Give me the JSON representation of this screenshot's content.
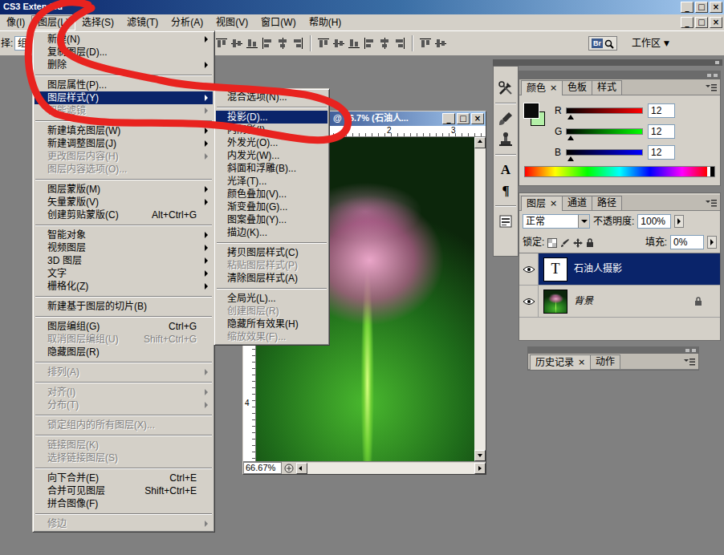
{
  "window": {
    "title": "CS3 Extended",
    "controls": [
      "_",
      "□",
      "×"
    ]
  },
  "menubar": {
    "items": [
      {
        "label": "像(I)",
        "selected": false
      },
      {
        "label": "图层(L)",
        "selected": true
      },
      {
        "label": "选择(S)",
        "selected": false
      },
      {
        "label": "滤镜(T)",
        "selected": false
      },
      {
        "label": "分析(A)",
        "selected": false
      },
      {
        "label": "视图(V)",
        "selected": false
      },
      {
        "label": "窗口(W)",
        "selected": false
      },
      {
        "label": "帮助(H)",
        "selected": false
      }
    ],
    "controls": [
      "_",
      "□",
      "×"
    ]
  },
  "options_bar": {
    "label": "择:",
    "dropdown": "组",
    "bridge": "Br",
    "workspace": "工作区",
    "workspace_arrow": "▼"
  },
  "layer_menu": {
    "groups": [
      [
        {
          "label": "新建(N)",
          "submenu": true,
          "disabled": false,
          "selected": false
        },
        {
          "label": "复制图层(D)...",
          "submenu": false,
          "disabled": false,
          "selected": false
        },
        {
          "label": "删除",
          "submenu": true,
          "disabled": false,
          "selected": false
        }
      ],
      [
        {
          "label": "图层属性(P)...",
          "submenu": false,
          "disabled": false,
          "selected": false
        },
        {
          "label": "图层样式(Y)",
          "submenu": true,
          "disabled": false,
          "selected": true
        },
        {
          "label": "智能滤镜",
          "submenu": true,
          "disabled": true,
          "selected": false
        }
      ],
      [
        {
          "label": "新建填充图层(W)",
          "submenu": true,
          "disabled": false,
          "selected": false
        },
        {
          "label": "新建调整图层(J)",
          "submenu": true,
          "disabled": false,
          "selected": false
        },
        {
          "label": "更改图层内容(H)",
          "submenu": true,
          "disabled": true,
          "selected": false
        },
        {
          "label": "图层内容选项(O)...",
          "submenu": false,
          "disabled": true,
          "selected": false
        }
      ],
      [
        {
          "label": "图层蒙版(M)",
          "submenu": true,
          "disabled": false,
          "selected": false
        },
        {
          "label": "矢量蒙版(V)",
          "submenu": true,
          "disabled": false,
          "selected": false
        },
        {
          "label": "创建剪贴蒙版(C)",
          "shortcut": "Alt+Ctrl+G",
          "submenu": false,
          "disabled": false,
          "selected": false
        }
      ],
      [
        {
          "label": "智能对象",
          "submenu": true,
          "disabled": false,
          "selected": false
        },
        {
          "label": "视频图层",
          "submenu": true,
          "disabled": false,
          "selected": false
        },
        {
          "label": "3D 图层",
          "submenu": true,
          "disabled": false,
          "selected": false
        },
        {
          "label": "文字",
          "submenu": true,
          "disabled": false,
          "selected": false
        },
        {
          "label": "栅格化(Z)",
          "submenu": true,
          "disabled": false,
          "selected": false
        }
      ],
      [
        {
          "label": "新建基于图层的切片(B)",
          "submenu": false,
          "disabled": false,
          "selected": false
        }
      ],
      [
        {
          "label": "图层编组(G)",
          "shortcut": "Ctrl+G",
          "submenu": false,
          "disabled": false,
          "selected": false
        },
        {
          "label": "取消图层编组(U)",
          "shortcut": "Shift+Ctrl+G",
          "submenu": false,
          "disabled": true,
          "selected": false
        },
        {
          "label": "隐藏图层(R)",
          "submenu": false,
          "disabled": false,
          "selected": false
        }
      ],
      [
        {
          "label": "排列(A)",
          "submenu": true,
          "disabled": true,
          "selected": false
        }
      ],
      [
        {
          "label": "对齐(I)",
          "submenu": true,
          "disabled": true,
          "selected": false
        },
        {
          "label": "分布(T)",
          "submenu": true,
          "disabled": true,
          "selected": false
        }
      ],
      [
        {
          "label": "锁定组内的所有图层(X)...",
          "submenu": false,
          "disabled": true,
          "selected": false
        }
      ],
      [
        {
          "label": "链接图层(K)",
          "submenu": false,
          "disabled": true,
          "selected": false
        },
        {
          "label": "选择链接图层(S)",
          "submenu": false,
          "disabled": true,
          "selected": false
        }
      ],
      [
        {
          "label": "向下合并(E)",
          "shortcut": "Ctrl+E",
          "submenu": false,
          "disabled": false,
          "selected": false
        },
        {
          "label": "合并可见图层",
          "shortcut": "Shift+Ctrl+E",
          "submenu": false,
          "disabled": false,
          "selected": false
        },
        {
          "label": "拼合图像(F)",
          "submenu": false,
          "disabled": false,
          "selected": false
        }
      ],
      [
        {
          "label": "修边",
          "submenu": true,
          "disabled": true,
          "selected": false
        }
      ]
    ]
  },
  "style_submenu": {
    "groups": [
      [
        {
          "label": "混合选项(N)...",
          "disabled": false,
          "selected": false
        }
      ],
      [
        {
          "label": "投影(D)...",
          "disabled": false,
          "selected": true
        },
        {
          "label": "内阴影(I)...",
          "disabled": false,
          "selected": false
        },
        {
          "label": "外发光(O)...",
          "disabled": false,
          "selected": false
        },
        {
          "label": "内发光(W)...",
          "disabled": false,
          "selected": false
        },
        {
          "label": "斜面和浮雕(B)...",
          "disabled": false,
          "selected": false
        },
        {
          "label": "光泽(T)...",
          "disabled": false,
          "selected": false
        },
        {
          "label": "颜色叠加(V)...",
          "disabled": false,
          "selected": false
        },
        {
          "label": "渐变叠加(G)...",
          "disabled": false,
          "selected": false
        },
        {
          "label": "图案叠加(Y)...",
          "disabled": false,
          "selected": false
        },
        {
          "label": "描边(K)...",
          "disabled": false,
          "selected": false
        }
      ],
      [
        {
          "label": "拷贝图层样式(C)",
          "disabled": false,
          "selected": false
        },
        {
          "label": "粘贴图层样式(P)",
          "disabled": true,
          "selected": false
        },
        {
          "label": "清除图层样式(A)",
          "disabled": false,
          "selected": false
        }
      ],
      [
        {
          "label": "全局光(L)...",
          "disabled": false,
          "selected": false
        },
        {
          "label": "创建图层(R)",
          "disabled": true,
          "selected": false
        },
        {
          "label": "隐藏所有效果(H)",
          "disabled": false,
          "selected": false
        },
        {
          "label": "缩放效果(F)...",
          "disabled": true,
          "selected": false
        }
      ]
    ]
  },
  "document": {
    "title": "@ 66.7% (石油人...",
    "controls": [
      "_",
      "□",
      "×"
    ],
    "ruler_h": [
      "2",
      "3"
    ],
    "ruler_v": [
      "4"
    ],
    "zoom": "66.67%"
  },
  "tools": [
    {
      "kind": "tools"
    },
    {
      "kind": "brushes"
    },
    {
      "kind": "clone-source"
    },
    {
      "kind": "character",
      "glyph": "A"
    },
    {
      "kind": "paragraph",
      "glyph": "¶"
    },
    {
      "kind": "layer-comps"
    }
  ],
  "color_panel": {
    "tabs": [
      {
        "label": "颜色",
        "selected": true
      },
      {
        "label": "色板",
        "selected": false
      },
      {
        "label": "样式",
        "selected": false
      }
    ],
    "close": "×",
    "foreground": "#0c0c0c",
    "background": "#b4f0a8",
    "channels": [
      {
        "name": "R",
        "value": "12",
        "level": 0.05,
        "color": "#ff0000"
      },
      {
        "name": "G",
        "value": "12",
        "level": 0.05,
        "color": "#00ff00"
      },
      {
        "name": "B",
        "value": "12",
        "level": 0.05,
        "color": "#0000ff"
      }
    ]
  },
  "layers_panel": {
    "tabs": [
      {
        "label": "图层",
        "selected": true
      },
      {
        "label": "通道",
        "selected": false
      },
      {
        "label": "路径",
        "selected": false
      }
    ],
    "close": "×",
    "blend_mode": "正常",
    "opacity_label": "不透明度:",
    "opacity": "100%",
    "lock_label": "锁定:",
    "fill_label": "填充:",
    "fill": "0%",
    "layers": [
      {
        "name": "石油人摄影",
        "kind": "text",
        "thumb": "T",
        "visible": true,
        "selected": true,
        "locked": false
      },
      {
        "name": "背景",
        "kind": "image",
        "visible": true,
        "selected": false,
        "locked": true
      }
    ]
  },
  "history_panel": {
    "tabs": [
      {
        "label": "历史记录",
        "selected": true
      },
      {
        "label": "动作",
        "selected": false
      }
    ],
    "close": "×"
  }
}
